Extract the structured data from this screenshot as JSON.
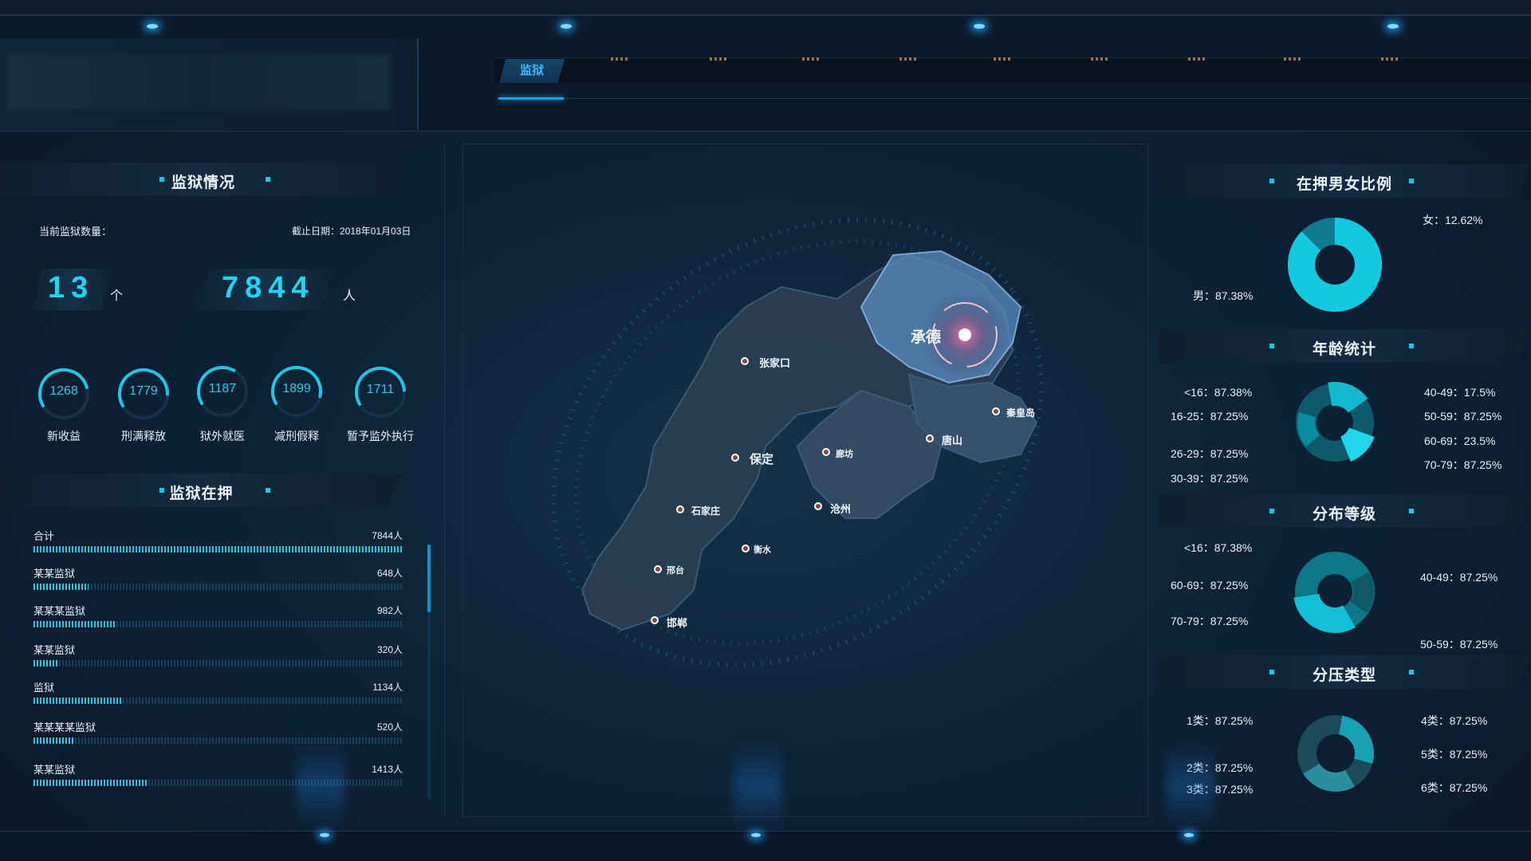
{
  "header": {
    "tab_active": "监狱"
  },
  "prison_status": {
    "title": "监狱情况",
    "count_label": "当前监狱数量：",
    "date_label": "截止日期：2018年01月03日",
    "prison_count": "13",
    "prison_unit": "个",
    "people_count": "7844",
    "people_unit": "人",
    "gauges": [
      {
        "value": "1268",
        "label": "新收益",
        "fraction": 0.72
      },
      {
        "value": "1779",
        "label": "刑满释放",
        "fraction": 0.78
      },
      {
        "value": "1187",
        "label": "狱外就医",
        "fraction": 0.55
      },
      {
        "value": "1899",
        "label": "减刑假释",
        "fraction": 0.82
      },
      {
        "value": "1711",
        "label": "暂予监外执行",
        "fraction": 0.76
      }
    ]
  },
  "detention": {
    "title": "监狱在押",
    "rows": [
      {
        "name": "合计",
        "value": "7844人",
        "fraction": 1.0
      },
      {
        "name": "某某监狱",
        "value": "648人",
        "fraction": 0.15
      },
      {
        "name": "某某某监狱",
        "value": "982人",
        "fraction": 0.22
      },
      {
        "name": "某某监狱",
        "value": "320人",
        "fraction": 0.07
      },
      {
        "name": "监狱",
        "value": "1134人",
        "fraction": 0.24
      },
      {
        "name": "某某某某监狱",
        "value": "520人",
        "fraction": 0.11
      },
      {
        "name": "某某监狱",
        "value": "1413人",
        "fraction": 0.31
      }
    ]
  },
  "map": {
    "cities": [
      {
        "name": "承德"
      },
      {
        "name": "张家口"
      },
      {
        "name": "秦皇岛"
      },
      {
        "name": "唐山"
      },
      {
        "name": "保定"
      },
      {
        "name": "廊坊"
      },
      {
        "name": "石家庄"
      },
      {
        "name": "沧州"
      },
      {
        "name": "衡水"
      },
      {
        "name": "邢台"
      },
      {
        "name": "邯郸"
      }
    ]
  },
  "gender": {
    "title": "在押男女比例",
    "female": "女：12.62%",
    "male": "男：87.38%",
    "female_value": 12.62,
    "male_value": 87.38
  },
  "age": {
    "title": "年龄统计",
    "left": [
      "<16：87.38%",
      "16-25：87.25%",
      "26-29：87.25%",
      "30-39：87.25%"
    ],
    "right": [
      "40-49：17.5%",
      "50-59：87.25%",
      "60-69：23.5%",
      "70-79：87.25%"
    ]
  },
  "level": {
    "title": "分布等级",
    "left": [
      "<16：87.38%",
      "60-69：87.25%",
      "70-79：87.25%"
    ],
    "right": [
      "40-49：87.25%",
      "50-59：87.25%"
    ]
  },
  "pressure": {
    "title": "分压类型",
    "left": [
      "1类：87.25%",
      "2类：87.25%",
      "3类：87.25%"
    ],
    "right": [
      "4类：87.25%",
      "5类：87.25%",
      "6类：87.25%"
    ]
  },
  "colors": {
    "accent": "#22d4f2",
    "teal_dark": "#0f6f80",
    "teal_mid": "#13a9be"
  }
}
